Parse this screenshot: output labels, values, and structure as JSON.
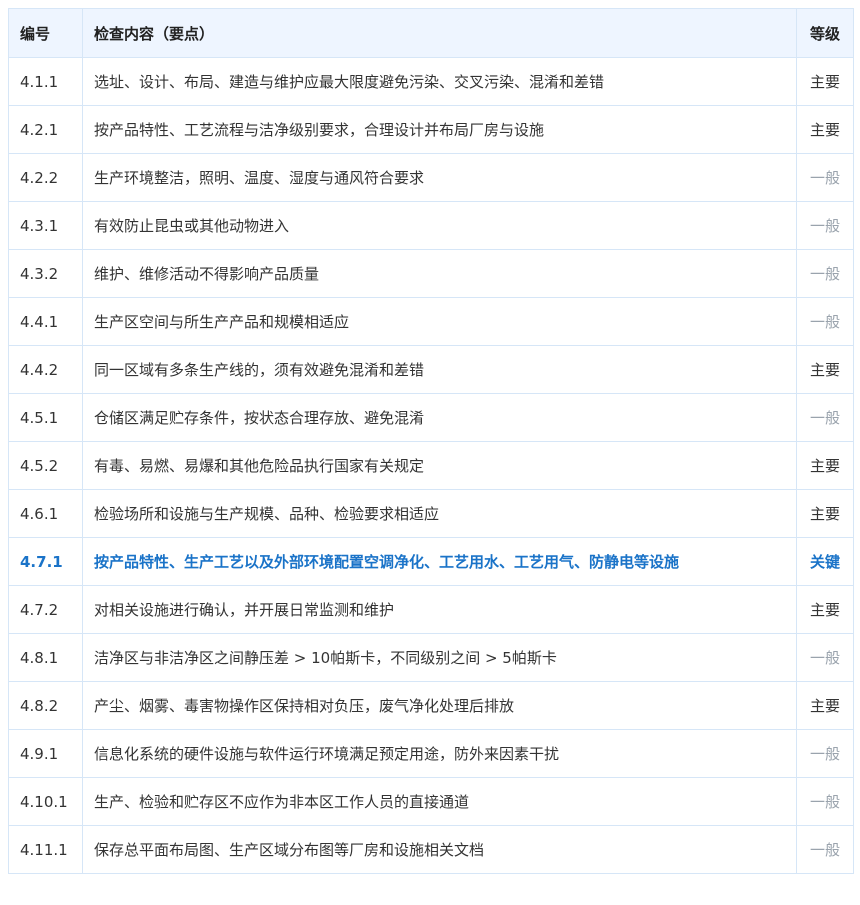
{
  "header": {
    "id": "编号",
    "content": "检查内容（要点）",
    "level": "等级"
  },
  "colors": {
    "main": "#333333",
    "normal": "#9aa3ad",
    "key": "#1a73c8",
    "header_bg": "#eef5ff",
    "border": "#d6e6f7"
  },
  "rows": [
    {
      "id": "4.1.1",
      "content": "选址、设计、布局、建造与维护应最大限度避免污染、交叉污染、混淆和差错",
      "level": "主要",
      "type": "main"
    },
    {
      "id": "4.2.1",
      "content": "按产品特性、工艺流程与洁净级别要求，合理设计并布局厂房与设施",
      "level": "主要",
      "type": "main"
    },
    {
      "id": "4.2.2",
      "content": "生产环境整洁，照明、温度、湿度与通风符合要求",
      "level": "一般",
      "type": "normal"
    },
    {
      "id": "4.3.1",
      "content": "有效防止昆虫或其他动物进入",
      "level": "一般",
      "type": "normal"
    },
    {
      "id": "4.3.2",
      "content": "维护、维修活动不得影响产品质量",
      "level": "一般",
      "type": "normal"
    },
    {
      "id": "4.4.1",
      "content": "生产区空间与所生产产品和规模相适应",
      "level": "一般",
      "type": "normal"
    },
    {
      "id": "4.4.2",
      "content": "同一区域有多条生产线的，须有效避免混淆和差错",
      "level": "主要",
      "type": "main"
    },
    {
      "id": "4.5.1",
      "content": "仓储区满足贮存条件，按状态合理存放、避免混淆",
      "level": "一般",
      "type": "normal"
    },
    {
      "id": "4.5.2",
      "content": "有毒、易燃、易爆和其他危险品执行国家有关规定",
      "level": "主要",
      "type": "main"
    },
    {
      "id": "4.6.1",
      "content": "检验场所和设施与生产规模、品种、检验要求相适应",
      "level": "主要",
      "type": "main"
    },
    {
      "id": "4.7.1",
      "content": "按产品特性、生产工艺以及外部环境配置空调净化、工艺用水、工艺用气、防静电等设施",
      "level": "关键",
      "type": "key"
    },
    {
      "id": "4.7.2",
      "content": "对相关设施进行确认，并开展日常监测和维护",
      "level": "主要",
      "type": "main"
    },
    {
      "id": "4.8.1",
      "content": "洁净区与非洁净区之间静压差 > 10帕斯卡，不同级别之间 > 5帕斯卡",
      "level": "一般",
      "type": "normal"
    },
    {
      "id": "4.8.2",
      "content": "产尘、烟雾、毒害物操作区保持相对负压，废气净化处理后排放",
      "level": "主要",
      "type": "main"
    },
    {
      "id": "4.9.1",
      "content": "信息化系统的硬件设施与软件运行环境满足预定用途，防外来因素干扰",
      "level": "一般",
      "type": "normal"
    },
    {
      "id": "4.10.1",
      "content": "生产、检验和贮存区不应作为非本区工作人员的直接通道",
      "level": "一般",
      "type": "normal"
    },
    {
      "id": "4.11.1",
      "content": "保存总平面布局图、生产区域分布图等厂房和设施相关文档",
      "level": "一般",
      "type": "normal"
    }
  ]
}
